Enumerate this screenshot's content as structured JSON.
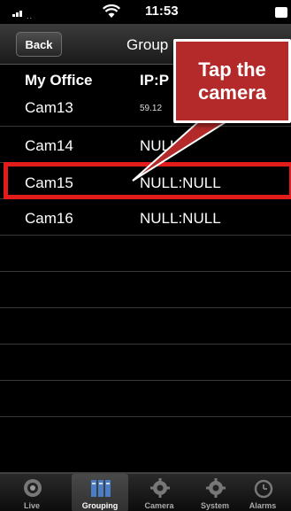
{
  "status_bar": {
    "time": "11:53"
  },
  "nav": {
    "back_label": "Back",
    "title": "Group"
  },
  "list": {
    "group_header": "My Office",
    "ip_header": "IP:P",
    "rows": [
      {
        "name": "Cam13",
        "ip": "59.12"
      },
      {
        "name": "Cam14",
        "ip": "NULL:"
      },
      {
        "name": "Cam15",
        "ip": "NULL:NULL"
      },
      {
        "name": "Cam16",
        "ip": "NULL:NULL"
      }
    ]
  },
  "callout": {
    "text": "Tap the\ncamera"
  },
  "tabs": [
    {
      "label": "Live",
      "icon": "live-icon"
    },
    {
      "label": "Grouping",
      "icon": "grouping-icon",
      "active": true
    },
    {
      "label": "Camera",
      "icon": "camera-gear-icon"
    },
    {
      "label": "System",
      "icon": "system-gear-icon"
    },
    {
      "label": "Alarms",
      "icon": "alarm-clock-icon"
    }
  ],
  "colors": {
    "highlight": "#e21b1b",
    "callout_bg": "#b42a2a"
  }
}
